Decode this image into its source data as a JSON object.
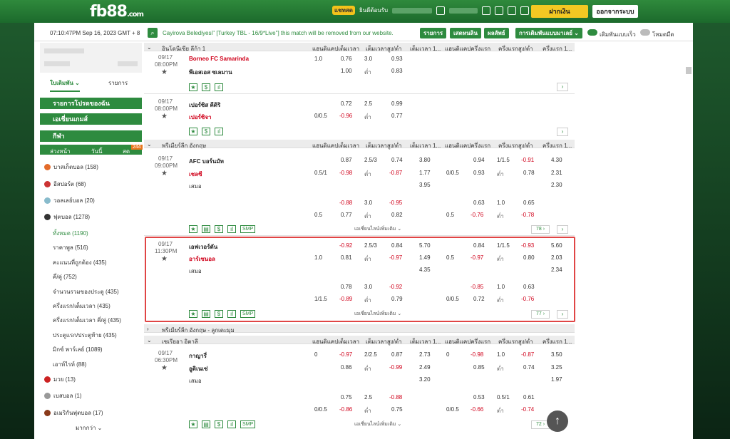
{
  "header": {
    "logo": "fb88",
    "logo_suffix": ".com",
    "chat": "แชทสด",
    "welcome": "ยินดีต้อนรับ",
    "deposit": "ฝากเงิน",
    "logout": "ออกจากระบบ"
  },
  "info": {
    "clock": "07:10:47PM Sep 16, 2023 GMT + 8",
    "announcement": "Cayirova Belediyesi\" [Turkey TBL - 16/9*Live\"] this match will be removed from our website.",
    "btn_list": "รายการ",
    "btn_live": "เสดหนลิน",
    "btn_result": "ผลลัพธ์",
    "btn_market": "การเดิมพันแบบมาเลย์",
    "toggle1": "เดิมพันแบบเร็ว",
    "toggle2": "โหมดมืด"
  },
  "sidebar": {
    "tab_bet": "ใบเดิมพัน",
    "tab_list": "รายการ",
    "my_list": "รายการโปรดของฉัน",
    "asian_games": "เอเชี่ยนเกมส์",
    "sports": "กีฬา",
    "sub_early": "ล่วงหน้า",
    "sub_today": "วันนี้",
    "sub_live": "สด",
    "live_badge": "244",
    "items": [
      {
        "label": "บาสเก็ตบอล (158)"
      },
      {
        "label": "อีสปอร์ต (68)"
      },
      {
        "label": "วอลเลย์บอล (20)"
      },
      {
        "label": "ฟุตบอล (1278)"
      }
    ],
    "subs": [
      {
        "label": "ทั้งหมด (1190)"
      },
      {
        "label": "ราคาพูล (516)"
      },
      {
        "label": "คะแนนที่ถูกต้อง (435)"
      },
      {
        "label": "คี่/คู่ (752)"
      },
      {
        "label": "จำนวนรวมของประตู (435)"
      },
      {
        "label": "ครึ่งแรก/เต็มเวลา (435)"
      },
      {
        "label": "ครึ่งแรก/เต็มเวลา คี่/คู่ (435)"
      },
      {
        "label": "ประตูแรก/ประตูท้าย (435)"
      },
      {
        "label": "มิกซ์ พาร์เลย์ (1089)"
      },
      {
        "label": "เอาท์ไรท์ (88)"
      }
    ],
    "items2": [
      {
        "label": "มวย (13)"
      },
      {
        "label": "เบสบอล (1)"
      },
      {
        "label": "อเมริกันฟุตบอล (17)"
      }
    ],
    "more": "มากกว่า"
  },
  "cols": {
    "c1": "แฮนดิแคปเต็มเวลา",
    "c2": "เต็มเวลาสูง/ต่ำ",
    "c3": "เต็มเวลา 1...",
    "c4": "แฮนดิแคปครึ่งแรก",
    "c5": "ครึ่งแรกสูง/ต่ำ",
    "c6": "ครึ่งแรก 1..."
  },
  "leagues": {
    "l1": "อินโดนีเซีย ลีก้า 1",
    "l2": "พรีเมียร์ลีก อังกฤษ",
    "l3": "พรีเมียร์ลีก อังกฤษ - ลูกเตะมุม",
    "l4": "เซเรียอา อิตาลี"
  },
  "m1": {
    "date": "09/17",
    "time": "08:00PM",
    "home": "Borneo FC Samarinda",
    "away": "พีเอสเอส ซเลมาน",
    "h1": "1.0",
    "o1": "0.76",
    "g1": "3.0",
    "u1": "0.93",
    "o2": "1.00",
    "g2": "ต่ำ",
    "u2": "0.83"
  },
  "m2": {
    "date": "09/17",
    "time": "08:00PM",
    "home": "เปอร์ซิส คีดิริ",
    "away": "เปอร์ซิจา",
    "o1": "0.72",
    "g1": "2.5",
    "u1": "0.99",
    "h2": "0/0.5",
    "o2": "-0.96",
    "g2": "ต่ำ",
    "u2": "0.77"
  },
  "m3": {
    "date": "09/17",
    "time": "09:00PM",
    "home": "AFC บอร์นมัท",
    "away": "เชลซี",
    "draw": "เสมอ",
    "a": [
      "0.87",
      "2.5/3",
      "0.74",
      "3.80",
      "0.94",
      "1/1.5",
      "-0.91",
      "4.30"
    ],
    "b": [
      "0.5/1",
      "-0.98",
      "ต่ำ",
      "-0.87",
      "1.77",
      "0/0.5",
      "0.93",
      "ต่ำ",
      "0.78",
      "2.31"
    ],
    "c": [
      "3.95",
      "2.30"
    ],
    "d": [
      "-0.88",
      "3.0",
      "-0.95",
      "0.63",
      "1.0",
      "0.65"
    ],
    "e": [
      "0.5",
      "0.77",
      "ต่ำ",
      "0.82",
      "0.5",
      "-0.76",
      "ต่ำ",
      "-0.78"
    ],
    "count": "78"
  },
  "m4": {
    "date": "09/17",
    "time": "11:30PM",
    "home": "เอฟเวอร์ตัน",
    "away": "อาร์เซนอล",
    "draw": "เสมอ",
    "a": [
      "-0.92",
      "2.5/3",
      "0.84",
      "5.70",
      "0.84",
      "1/1.5",
      "-0.93",
      "5.60"
    ],
    "b": [
      "1.0",
      "0.81",
      "ต่ำ",
      "-0.97",
      "1.49",
      "0.5",
      "-0.97",
      "ต่ำ",
      "0.80",
      "2.03"
    ],
    "c": [
      "4.35",
      "2.34"
    ],
    "d": [
      "0.78",
      "3.0",
      "-0.92",
      "-0.85",
      "1.0",
      "0.63"
    ],
    "e": [
      "1/1.5",
      "-0.89",
      "ต่ำ",
      "0.79",
      "0/0.5",
      "0.72",
      "ต่ำ",
      "-0.76"
    ],
    "count": "77"
  },
  "m5": {
    "date": "09/17",
    "time": "06:30PM",
    "home": "กาญารี่",
    "away": "อูดิเนเซ่",
    "draw": "เสมอ",
    "a": [
      "0",
      "-0.97",
      "2/2.5",
      "0.87",
      "2.73",
      "0",
      "-0.98",
      "1.0",
      "-0.87",
      "3.50"
    ],
    "b": [
      "0.86",
      "ต่ำ",
      "-0.99",
      "2.49",
      "0.85",
      "ต่ำ",
      "0.74",
      "3.25"
    ],
    "c": [
      "3.20",
      "1.97"
    ],
    "d": [
      "0.75",
      "2.5",
      "-0.88",
      "0.53",
      "0.5/1",
      "0.61"
    ],
    "e": [
      "0/0.5",
      "-0.86",
      "ต่ำ",
      "0.75",
      "0/0.5",
      "-0.66",
      "ต่ำ",
      "-0.74"
    ],
    "count": "72"
  },
  "more_lines": "เอเชี่ยนไลน์เพิ่มเติม",
  "smp": "SMP"
}
